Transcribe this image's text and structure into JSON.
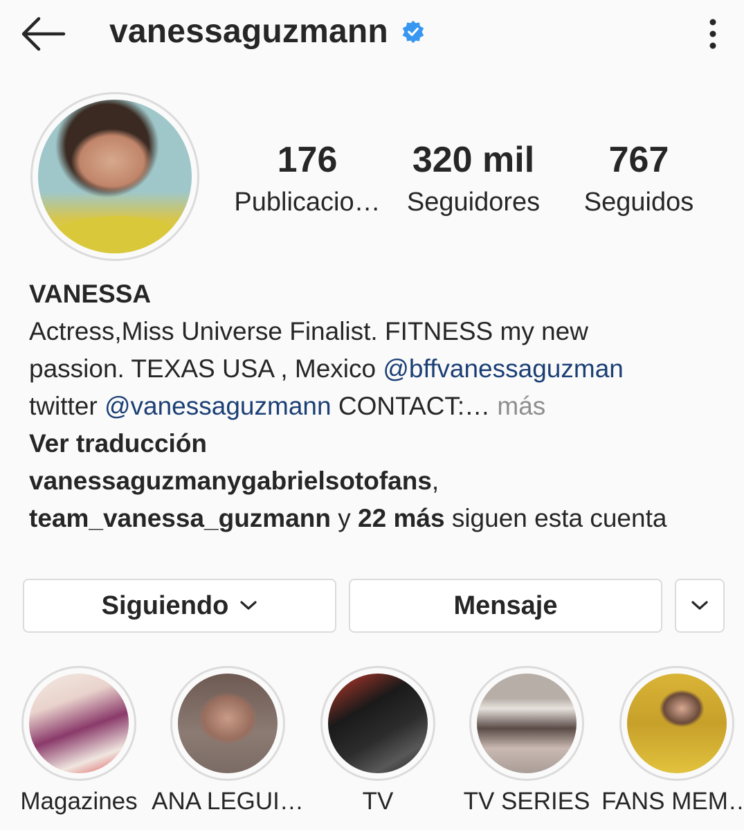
{
  "header": {
    "username": "vanessaguzmann",
    "back_icon": "arrow-left-icon",
    "verified_icon": "verified-badge-icon",
    "more_icon": "vertical-dots-icon",
    "verified_color": "#3897f0"
  },
  "stats": {
    "posts": {
      "value": "176",
      "label": "Publicacio…"
    },
    "followers": {
      "value": "320 mil",
      "label": "Seguidores"
    },
    "following": {
      "value": "767",
      "label": "Seguidos"
    }
  },
  "bio": {
    "display_name": "VANESSA",
    "line1": "Actress,Miss Universe Finalist.  FITNESS my new",
    "line2_text": "passion. TEXAS USA , Mexico ",
    "line2_mention": "@bffvanessaguzman",
    "line3_text": "twitter ",
    "line3_mention": "@vanessaguzmann",
    "line3_after": " CONTACT:…",
    "more_label": " más",
    "translate_label": "Ver traducción",
    "followed_by_1": "vanessaguzmanygabrielsotofans",
    "followed_by_comma": ",",
    "followed_by_2": "team_vanessa_guzmann",
    "followed_by_y": " y ",
    "followed_by_more": "22 más",
    "followed_by_suffix": " siguen esta cuenta",
    "mention_color": "#1b3f75"
  },
  "actions": {
    "following_label": "Siguiendo",
    "message_label": "Mensaje",
    "suggest_icon": "chevron-down-icon"
  },
  "highlights": [
    {
      "label": "Magazines"
    },
    {
      "label": "ANA LEGUI…"
    },
    {
      "label": "TV"
    },
    {
      "label": "TV SERIES"
    },
    {
      "label": "FANS MEM…"
    }
  ]
}
